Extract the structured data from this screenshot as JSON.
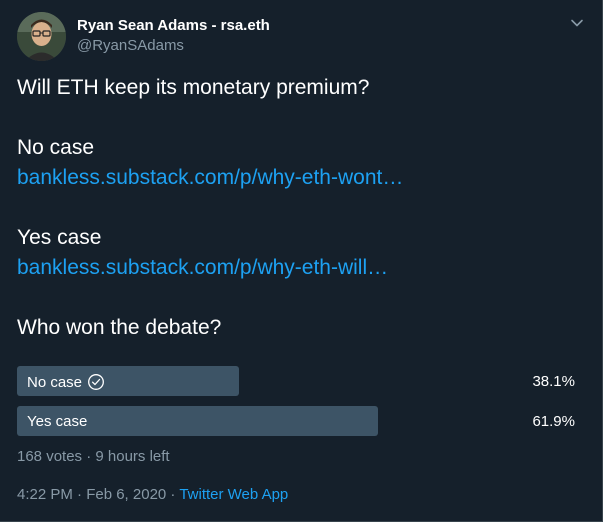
{
  "author": {
    "name": "Ryan Sean Adams - rsa.eth",
    "handle": "@RyanSAdams"
  },
  "tweet": {
    "question": "Will ETH keep its monetary premium?",
    "no_case_heading": "No case",
    "no_case_link": "bankless.substack.com/p/why-eth-wont…",
    "yes_case_heading": "Yes case",
    "yes_case_link": "bankless.substack.com/p/why-eth-will…",
    "poll_question": "Who won the debate?"
  },
  "poll": {
    "options": [
      {
        "label": "No case",
        "percent_text": "38.1%",
        "fraction": 0.381
      },
      {
        "label": "Yes case",
        "percent_text": "61.9%",
        "fraction": 0.619
      }
    ],
    "meta": "168 votes · 9 hours left"
  },
  "footer": {
    "timestamp": "4:22 PM · Feb 6, 2020 · ",
    "source": "Twitter Web App"
  },
  "colors": {
    "background": "#15202b",
    "link": "#1da1f2",
    "secondary_text": "#8899a6",
    "poll_bar": "#3d5466"
  }
}
